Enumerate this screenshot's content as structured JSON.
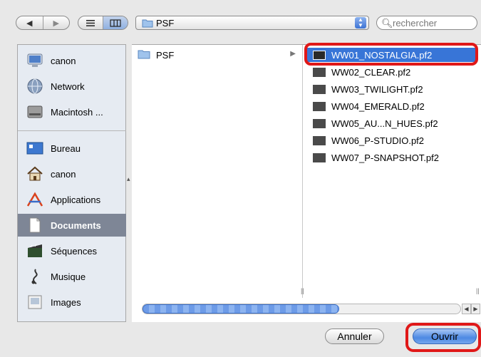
{
  "toolbar": {
    "nav_back_icon": "back-arrow-icon",
    "nav_forward_icon": "forward-arrow-icon",
    "view_list_icon": "list-view-icon",
    "view_column_icon": "column-view-icon",
    "path_label": "PSF",
    "search_placeholder": "rechercher"
  },
  "sidebar": {
    "devices": [
      {
        "label": "canon",
        "icon": "computer-icon"
      },
      {
        "label": "Network",
        "icon": "network-globe-icon"
      },
      {
        "label": "Macintosh ...",
        "icon": "hard-drive-icon"
      }
    ],
    "places": [
      {
        "label": "Bureau",
        "icon": "desktop-icon"
      },
      {
        "label": "canon",
        "icon": "home-icon"
      },
      {
        "label": "Applications",
        "icon": "applications-icon"
      },
      {
        "label": "Documents",
        "icon": "documents-icon",
        "selected": true
      },
      {
        "label": "Séquences",
        "icon": "movies-icon"
      },
      {
        "label": "Musique",
        "icon": "music-icon"
      },
      {
        "label": "Images",
        "icon": "pictures-icon"
      }
    ]
  },
  "browser": {
    "column1": {
      "label": "PSF"
    },
    "files": [
      {
        "label": "WW01_NOSTALGIA.pf2",
        "selected": true
      },
      {
        "label": "WW02_CLEAR.pf2"
      },
      {
        "label": "WW03_TWILIGHT.pf2"
      },
      {
        "label": "WW04_EMERALD.pf2"
      },
      {
        "label": "WW05_AU...N_HUES.pf2"
      },
      {
        "label": "WW06_P-STUDIO.pf2"
      },
      {
        "label": "WW07_P-SNAPSHOT.pf2"
      }
    ]
  },
  "footer": {
    "cancel_label": "Annuler",
    "open_label": "Ouvrir"
  },
  "colors": {
    "selection": "#3875d7",
    "highlight_ring": "#e01818",
    "sidebar_selected": "#7e8696"
  }
}
